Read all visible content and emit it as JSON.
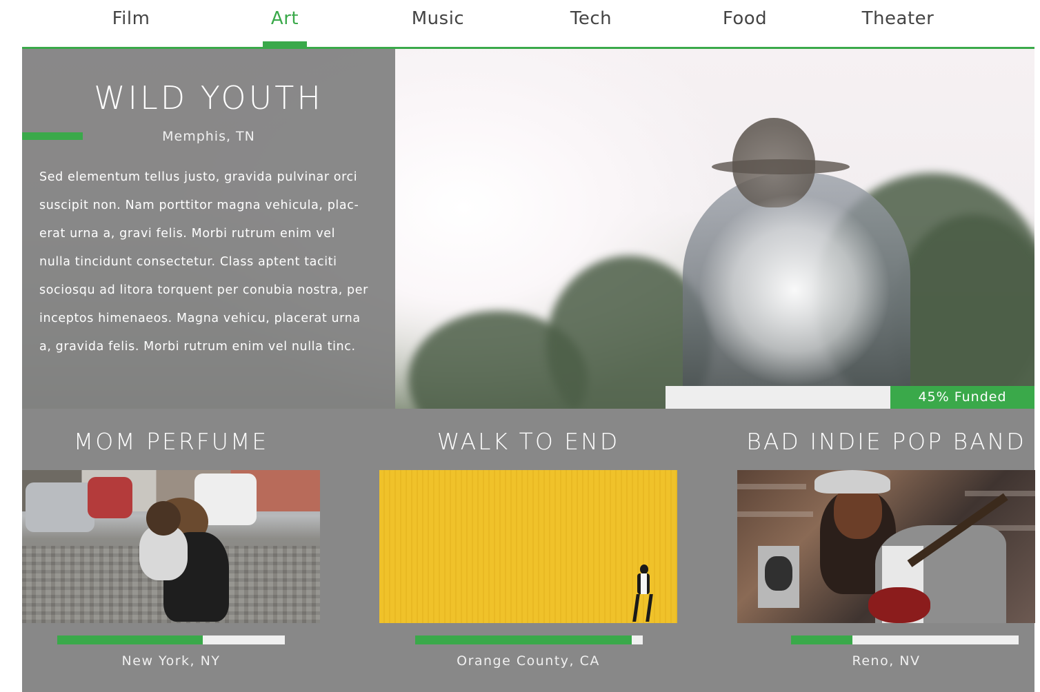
{
  "nav": {
    "tabs": [
      {
        "label": "Film",
        "active": false
      },
      {
        "label": "Art",
        "active": true
      },
      {
        "label": "Music",
        "active": false
      },
      {
        "label": "Tech",
        "active": false
      },
      {
        "label": "Food",
        "active": false
      },
      {
        "label": "Theater",
        "active": false
      }
    ]
  },
  "featured": {
    "title": "WILD YOUTH",
    "location": "Memphis, TN",
    "description": "Sed elementum tellus justo, gravida pulvinar orci suscipit non. Nam porttitor magna vehicula, plac-erat urna a, gravi felis. Morbi rutrum enim vel nulla tincidunt consectetur. Class aptent taciti sociosqu ad litora torquent per conubia nostra, per inceptos himenaeos. Magna vehicu, placerat urna a, gravida felis. Morbi rutrum enim vel nulla tinc.",
    "funded_label": "45% Funded",
    "funded_percent": 45
  },
  "projects": [
    {
      "title": "MOM PERFUME",
      "location": "New York, NY",
      "progress": 0.64
    },
    {
      "title": "WALK TO END",
      "location": "Orange County, CA",
      "progress": 0.95
    },
    {
      "title": "BAD INDIE POP BAND",
      "location": "Reno, NV",
      "progress": 0.27
    }
  ],
  "colors": {
    "accent": "#3aa94a",
    "panel": "#888888",
    "nav_text": "#444444"
  }
}
